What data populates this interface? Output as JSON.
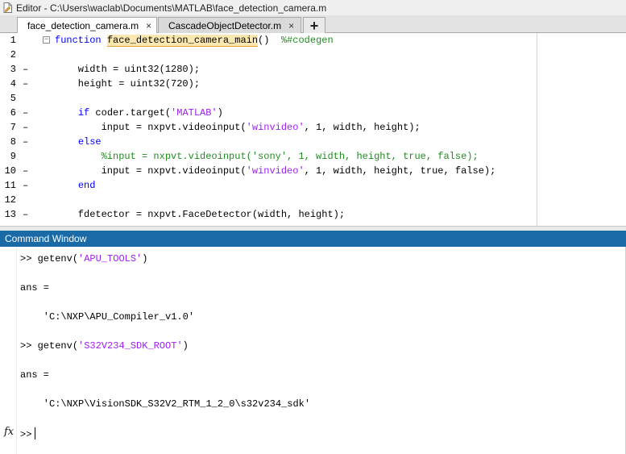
{
  "editor": {
    "title": "Editor - C:\\Users\\waclab\\Documents\\MATLAB\\face_detection_camera.m",
    "tabs": [
      {
        "label": "face_detection_camera.m",
        "close": "×"
      },
      {
        "label": "CascadeObjectDetector.m",
        "close": "×"
      }
    ],
    "add_tab": "+",
    "lines": [
      {
        "n": "1",
        "dash": "",
        "fold": "−"
      },
      {
        "n": "2",
        "dash": ""
      },
      {
        "n": "3",
        "dash": "–"
      },
      {
        "n": "4",
        "dash": "–"
      },
      {
        "n": "5",
        "dash": ""
      },
      {
        "n": "6",
        "dash": "–"
      },
      {
        "n": "7",
        "dash": "–"
      },
      {
        "n": "8",
        "dash": "–"
      },
      {
        "n": "9",
        "dash": ""
      },
      {
        "n": "10",
        "dash": "–"
      },
      {
        "n": "11",
        "dash": "–"
      },
      {
        "n": "12",
        "dash": ""
      },
      {
        "n": "13",
        "dash": "–"
      }
    ],
    "code": {
      "l1_kw": "function",
      "l1_name": "face_detection_camera_main",
      "l1_rest": "()  ",
      "l1_cmt": "%#codegen",
      "l3": "    width = uint32(1280);",
      "l4": "    height = uint32(720);",
      "l6_kw": "if",
      "l6_a": " coder.target(",
      "l6_str": "'MATLAB'",
      "l6_b": ")",
      "l7_a": "        input = nxpvt.videoinput(",
      "l7_str": "'winvideo'",
      "l7_b": ", 1, width, height);",
      "l8_kw": "else",
      "l9_cmt": "        %input = nxpvt.videoinput('sony', 1, width, height, true, false);",
      "l10_a": "        input = nxpvt.videoinput(",
      "l10_str": "'winvideo'",
      "l10_b": ", 1, width, height, true, false);",
      "l11_kw": "end",
      "l13": "    fdetector = nxpvt.FaceDetector(width, height);"
    }
  },
  "command_window": {
    "title": "Command Window",
    "prompt": ">> ",
    "cmd1_a": "getenv(",
    "cmd1_str": "'APU_TOOLS'",
    "cmd1_b": ")",
    "ans1": "ans =",
    "val1": "    'C:\\NXP\\APU_Compiler_v1.0'",
    "cmd2_a": "getenv(",
    "cmd2_str": "'S32V234_SDK_ROOT'",
    "cmd2_b": ")",
    "ans2": "ans =",
    "val2": "    'C:\\NXP\\VisionSDK_S32V2_RTM_1_2_0\\s32v234_sdk'",
    "fx": "fx",
    "final_prompt": ">>"
  }
}
